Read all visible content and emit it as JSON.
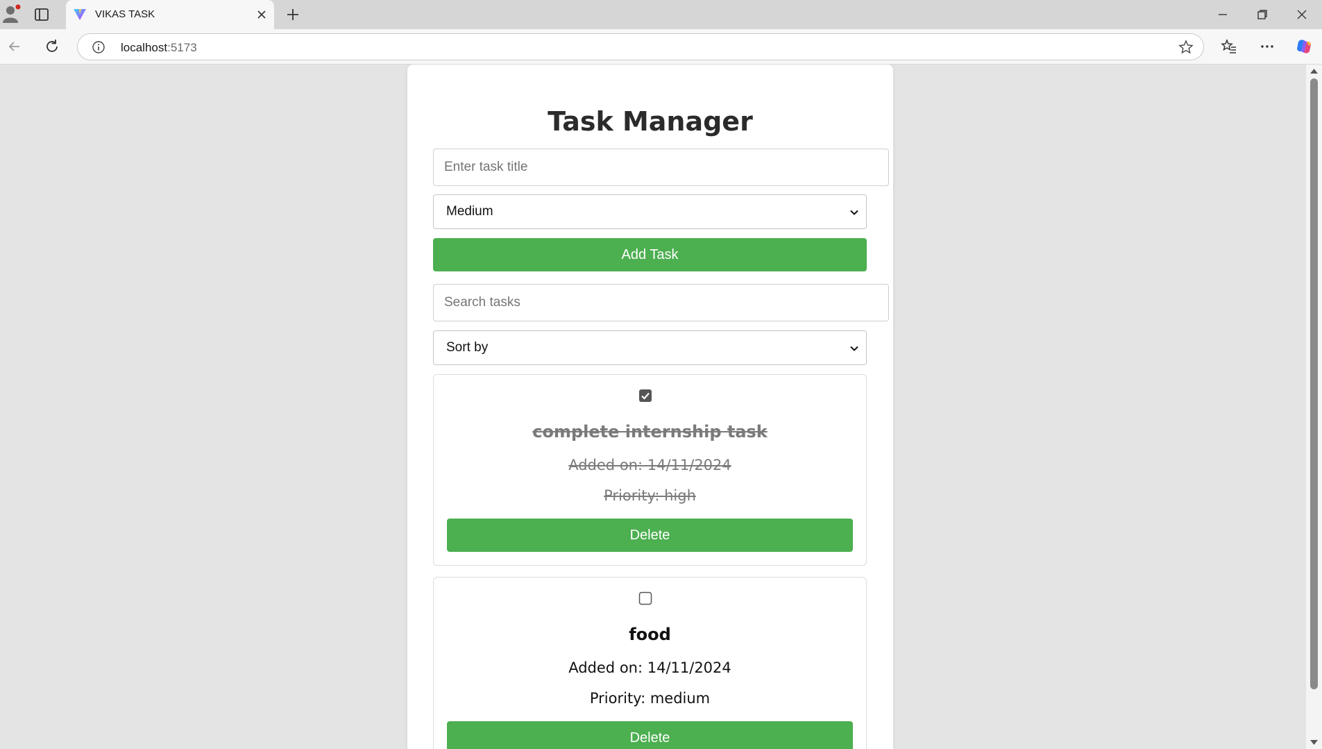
{
  "browser": {
    "tab_title": "VIKAS TASK",
    "url_host": "localhost",
    "url_port": ":5173"
  },
  "app": {
    "title": "Task Manager",
    "task_title_placeholder": "Enter task title",
    "priority_selected": "Medium",
    "add_button": "Add Task",
    "search_placeholder": "Search tasks",
    "sort_selected": "Sort by"
  },
  "tasks": [
    {
      "title": "complete internship task",
      "added": "Added on: 14/11/2024",
      "priority": "Priority: high",
      "completed": true,
      "delete_label": "Delete"
    },
    {
      "title": "food",
      "added": "Added on: 14/11/2024",
      "priority": "Priority: medium",
      "completed": false,
      "delete_label": "Delete"
    }
  ],
  "colors": {
    "accent_green": "#4caf50",
    "completed_text": "#7a7a7a"
  }
}
